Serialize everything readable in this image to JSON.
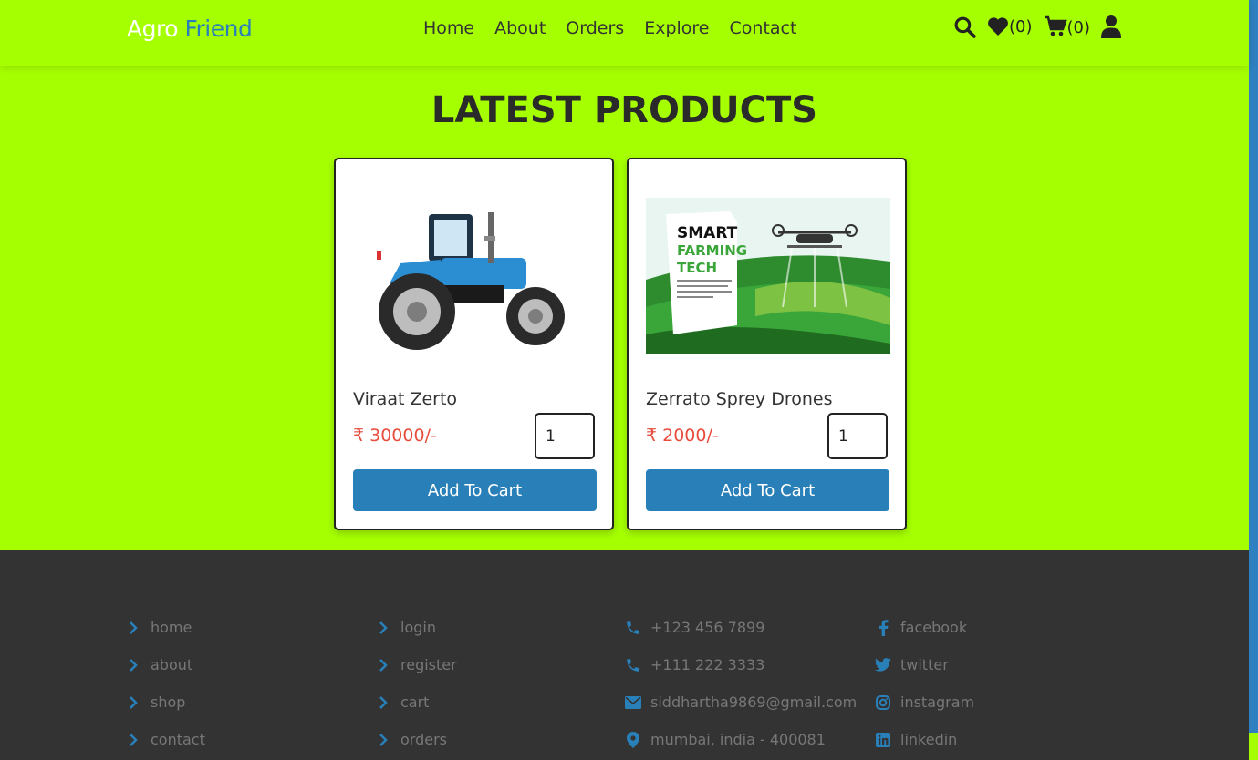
{
  "header": {
    "logo_part1": "Agro",
    "logo_part2": "Friend",
    "nav": [
      "Home",
      "About",
      "Orders",
      "Explore",
      "Contact"
    ],
    "wishlist_count": "(0)",
    "cart_count": "(0)"
  },
  "main": {
    "title": "LATEST PRODUCTS",
    "products": [
      {
        "name": "Viraat Zerto",
        "price": "₹ 30000/-",
        "qty": "1",
        "button": "Add To Cart"
      },
      {
        "name": "Zerrato Sprey Drones",
        "price": "₹ 2000/-",
        "qty": "1",
        "button": "Add To Cart",
        "image_text": [
          "SMART",
          "FARMING",
          "TECH"
        ]
      }
    ]
  },
  "footer": {
    "col1": [
      "home",
      "about",
      "shop",
      "contact"
    ],
    "col2": [
      "login",
      "register",
      "cart",
      "orders"
    ],
    "col3": [
      "+123 456 7899",
      "+111 222 3333",
      "siddhartha9869@gmail.com",
      "mumbai, india - 400081"
    ],
    "col4": [
      "facebook",
      "twitter",
      "instagram",
      "linkedin"
    ]
  },
  "colors": {
    "accent": "#2980b9",
    "background": "#a6ff00",
    "price": "#e74c3c",
    "footer": "#333333"
  }
}
